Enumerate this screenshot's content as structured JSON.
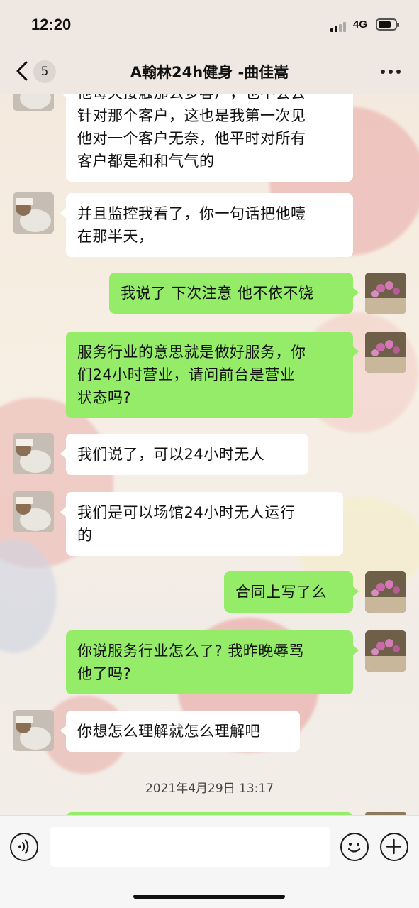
{
  "status": {
    "time": "12:20",
    "network": "4G"
  },
  "nav": {
    "unread_count": "5",
    "title": "A翰林24h健身 -曲佳嵩"
  },
  "messages": [
    {
      "side": "left",
      "lines": [
        "他每天接触那么多客户，也不会去",
        "针对那个客户，这也是我第一次见",
        "他对一个客户无奈，他平时对所有",
        "客户都是和和气气的"
      ]
    },
    {
      "side": "left",
      "lines": [
        "并且监控我看了，你一句话把他噎",
        "在那半天，"
      ]
    },
    {
      "side": "right",
      "lines": [
        "我说了 下次注意 他不依不饶"
      ]
    },
    {
      "side": "right",
      "lines": [
        "服务行业的意思就是做好服务，你",
        "们24小时营业，请问前台是营业",
        "状态吗?"
      ]
    },
    {
      "side": "left",
      "lines": [
        "我们说了，可以24小时无人"
      ]
    },
    {
      "side": "left",
      "lines": [
        "我们是可以场馆24小时无人运行",
        "的"
      ]
    },
    {
      "side": "right",
      "lines": [
        "合同上写了么"
      ]
    },
    {
      "side": "right",
      "lines": [
        "你说服务行业怎么了? 我昨晚辱骂",
        "他了吗?"
      ]
    },
    {
      "side": "left",
      "lines": [
        "你想怎么理解就怎么理解吧"
      ]
    }
  ],
  "timestamp": "2021年4月29日 13:17",
  "input": {
    "placeholder": ""
  },
  "colors": {
    "self_bubble": "#95ec69",
    "other_bubble": "#ffffff",
    "background": "#f4ece4"
  },
  "icons": [
    "back-chevron-icon",
    "more-dots-icon",
    "voice-icon",
    "emoji-icon",
    "plus-icon"
  ]
}
